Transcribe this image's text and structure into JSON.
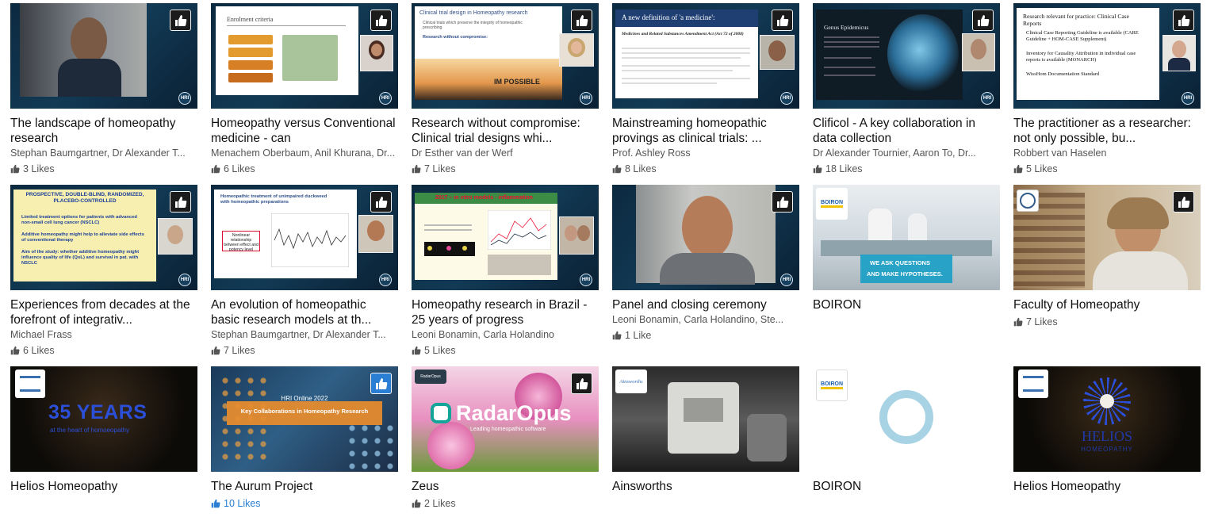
{
  "colors": {
    "accent": "#2a7fd4",
    "text": "#111111",
    "muted": "#555555",
    "like_button_bg": "#1b1b1b"
  },
  "icons": {
    "like": "thumbs-up-icon",
    "badge": "hri-badge"
  },
  "cards": [
    {
      "title": "The landscape of homeopathy research",
      "speakers": "Stephan Baumgartner, Dr Alexander T...",
      "likes": "3 Likes"
    },
    {
      "title": "Homeopathy versus Conventional medicine - can",
      "speakers": "Menachem Oberbaum, Anil Khurana, Dr...",
      "likes": "6 Likes",
      "slide_title": "Enrolment criteria"
    },
    {
      "title": "Research without compromise: Clinical trial designs whi...",
      "speakers": "Dr Esther van der Werf",
      "likes": "7 Likes",
      "slide_title": "Clinical trial design in Homeopathy research",
      "slide_line1": "Clinical trials which preserve the integrity of homeopathic prescribing",
      "slide_line2": "Research without compromise:",
      "slide_word": "IM POSSIBLE"
    },
    {
      "title": "Mainstreaming homeopathic provings as clinical trials: ...",
      "speakers": "Prof. Ashley Ross",
      "likes": "8 Likes",
      "slide_title": "A new definition of 'a medicine':",
      "slide_sub": "Medicines and Related Substances Amendment Act (Act 72 of 2008)"
    },
    {
      "title": "Clificol - A key collaboration in data collection",
      "speakers": "Dr Alexander Tournier, Aaron To, Dr...",
      "likes": "18 Likes",
      "slide_title": "Genus Epidemicus"
    },
    {
      "title": "The practitioner as a researcher: not only possible, bu...",
      "speakers": "Robbert van Haselen",
      "likes": "5 Likes",
      "slide_title": "Research relevant for practice: Clinical Case Reports",
      "slide_bullets": [
        "Clinical Case Reporting Guideline is available (CARE Guideline + HOM-CASE Supplement)",
        "Inventory for Causality Attribution in individual case reports is available (MONARCH)",
        "WissHom Documentation Standard"
      ]
    },
    {
      "title": "Experiences from decades at the forefront of integrativ...",
      "speakers": "Michael Frass",
      "likes": "6 Likes",
      "slide_title": "PROSPECTIVE, DOUBLE-BLIND, RANDOMIZED, PLACEBO-CONTROLLED",
      "slide_bullets": [
        "Limited treatment options for patients with advanced non-small cell lung cancer (NSCLC)",
        "Additive homeopathy might help to alleviate side effects of conventional therapy",
        "Aim of the study: whether additive homeopathy might influence quality of life (QoL) and survival in pat. with NSCLC"
      ]
    },
    {
      "title": "An evolution of homeopathic basic research models at th...",
      "speakers": "Stephan Baumgartner, Dr Alexander T...",
      "likes": "7 Likes",
      "slide_title": "Homeopathic treatment of unimpaired duckweed with homeopathic preparations",
      "slide_box": "Nonlinear relationship between effect and potency level"
    },
    {
      "title": "Homeopathy research in Brazil - 25 years of progress",
      "speakers": "Leoni Bonamin, Carla Holandino",
      "likes": "5 Likes",
      "slide_title": "2017 – in vitro models - inflammation"
    },
    {
      "title": "Panel and closing ceremony",
      "speakers": "Leoni Bonamin, Carla Holandino, Ste...",
      "likes": "1 Like"
    },
    {
      "title": "BOIRON",
      "logo": "BOIRON",
      "banner1": "WE ASK QUESTIONS",
      "banner2": "AND MAKE HYPOTHESES."
    },
    {
      "title": "Faculty of Homeopathy",
      "likes": "7 Likes"
    },
    {
      "title": "Helios Homeopathy",
      "big_text": "35 YEARS",
      "small_text": "at the heart of homoeopathy"
    },
    {
      "title": "The Aurum Project",
      "likes": "10 Likes",
      "banner1": "HRI Online 2022",
      "banner2": "Key Collaborations in Homeopathy Research"
    },
    {
      "title": "Zeus",
      "likes": "2 Likes",
      "brand": "RadarOpus",
      "tagline": "Leading homeopathic software"
    },
    {
      "title": "Ainsworths",
      "logo": "Ainsworths"
    },
    {
      "title": "BOIRON",
      "logo": "BOIRON"
    },
    {
      "title": "Helios Homeopathy",
      "word1": "HELIOS",
      "word2": "HOMEOPATHY"
    }
  ]
}
